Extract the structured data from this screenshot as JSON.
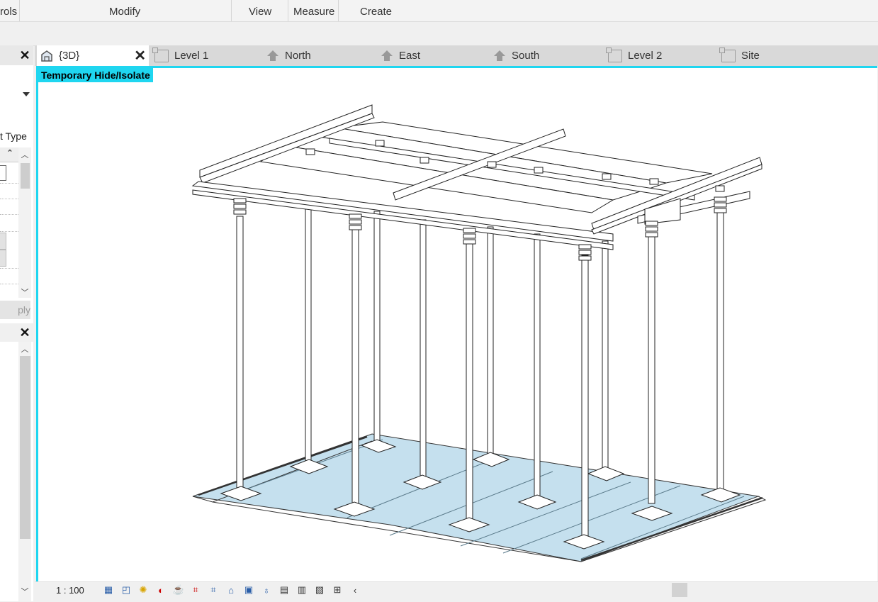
{
  "ribbon": {
    "panels": [
      "rols",
      "Modify",
      "View",
      "Measure",
      "Create"
    ]
  },
  "properties": {
    "type_label": "t Type",
    "apply_label": "ply"
  },
  "tabs": [
    {
      "label": "{3D}",
      "icon": "3d-house-icon",
      "active": true
    },
    {
      "label": "Level 1",
      "icon": "floor-plan-icon"
    },
    {
      "label": "North",
      "icon": "elevation-icon"
    },
    {
      "label": "East",
      "icon": "elevation-icon"
    },
    {
      "label": "South",
      "icon": "elevation-icon"
    },
    {
      "label": "Level 2",
      "icon": "floor-plan-icon"
    },
    {
      "label": "Site",
      "icon": "floor-plan-icon"
    }
  ],
  "viewport": {
    "mode_banner": "Temporary Hide/Isolate",
    "border_color": "#1fd6f0"
  },
  "view_control_bar": {
    "scale": "1 : 100",
    "icons": [
      "detail-level-icon",
      "visual-style-icon",
      "sun-path-icon",
      "shadows-icon",
      "render-icon",
      "crop-view-icon",
      "show-crop-icon",
      "lock-3d-icon",
      "temporary-hide-icon",
      "reveal-hidden-icon",
      "highlight-displacement-icon",
      "worksharing-icon",
      "analytical-model-icon",
      "constraints-icon",
      "collapse-icon"
    ]
  },
  "colors": {
    "accent_cyan": "#1fd6f0",
    "deck_blue": "#c5e0ee"
  }
}
